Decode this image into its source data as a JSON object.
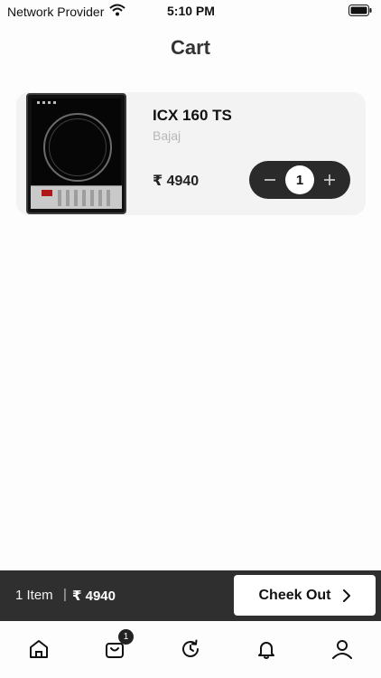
{
  "status_bar": {
    "carrier": "Network Provider",
    "time": "5:10 PM"
  },
  "header": {
    "title": "Cart"
  },
  "cart": {
    "items": [
      {
        "name": "ICX 160 TS",
        "brand": "Bajaj",
        "price": "₹ 4940",
        "quantity": "1"
      }
    ]
  },
  "summary": {
    "count": "1 Item",
    "separator": "|",
    "total": "₹ 4940",
    "checkout_label": "Cheek Out"
  },
  "bottom_nav": {
    "items": [
      {
        "icon": "home-icon"
      },
      {
        "icon": "bag-icon",
        "badge": "1"
      },
      {
        "icon": "history-icon"
      },
      {
        "icon": "bell-icon"
      },
      {
        "icon": "user-icon"
      }
    ]
  },
  "colors": {
    "background": "#fdfdfd",
    "card": "#f3f3f3",
    "dark": "#2f2f2f",
    "stepper": "#2a2a2a",
    "brand_text": "#b7b7b7"
  }
}
